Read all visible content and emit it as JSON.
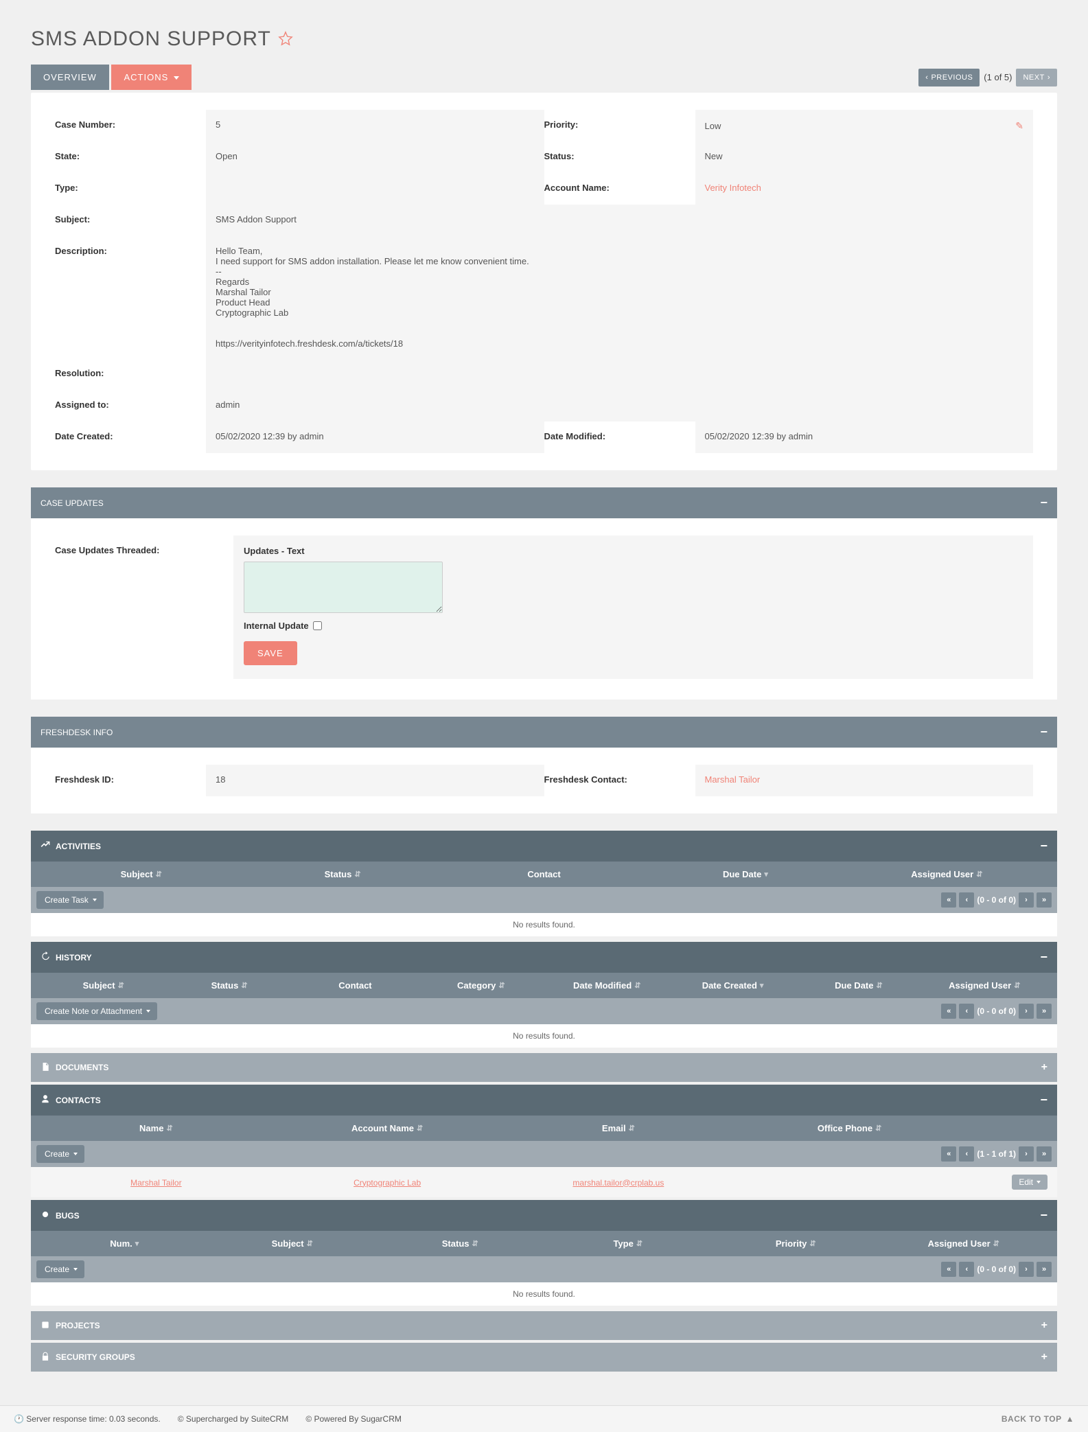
{
  "page_title": "SMS ADDON SUPPORT",
  "tabs": {
    "overview": "OVERVIEW",
    "actions": "ACTIONS"
  },
  "nav": {
    "prev": "PREVIOUS",
    "pos": "(1 of 5)",
    "next": "NEXT"
  },
  "case": {
    "labels": {
      "case_number": "Case Number:",
      "priority": "Priority:",
      "state": "State:",
      "status": "Status:",
      "type": "Type:",
      "account_name": "Account Name:",
      "subject": "Subject:",
      "description": "Description:",
      "resolution": "Resolution:",
      "assigned_to": "Assigned to:",
      "date_created": "Date Created:",
      "date_modified": "Date Modified:"
    },
    "case_number": "5",
    "priority": "Low",
    "state": "Open",
    "status": "New",
    "type": "",
    "account_name": "Verity Infotech",
    "subject": "SMS Addon Support",
    "description": "Hello Team,\nI need support for SMS addon installation. Please let me know convenient time.\n--\nRegards\nMarshal Tailor\nProduct Head\nCryptographic Lab\n\n\nhttps://verityinfotech.freshdesk.com/a/tickets/18",
    "resolution": "",
    "assigned_to": "admin",
    "date_created": "05/02/2020 12:39 by admin",
    "date_modified": "05/02/2020 12:39 by admin"
  },
  "case_updates": {
    "header": "CASE UPDATES",
    "threaded_label": "Case Updates Threaded:",
    "updates_text_label": "Updates - Text",
    "internal_update_label": "Internal Update",
    "save": "SAVE"
  },
  "freshdesk": {
    "header": "FRESHDESK INFO",
    "id_label": "Freshdesk ID:",
    "id_value": "18",
    "contact_label": "Freshdesk Contact:",
    "contact_value": "Marshal Tailor"
  },
  "subpanels": {
    "activities": {
      "title": "ACTIVITIES",
      "cols": [
        "Subject",
        "Status",
        "Contact",
        "Due Date",
        "Assigned User"
      ],
      "create": "Create Task",
      "pager_range": "(0 - 0 of 0)",
      "empty": "No results found."
    },
    "history": {
      "title": "HISTORY",
      "cols": [
        "Subject",
        "Status",
        "Contact",
        "Category",
        "Date Modified",
        "Date Created",
        "Due Date",
        "Assigned User"
      ],
      "create": "Create Note or Attachment",
      "pager_range": "(0 - 0 of 0)",
      "empty": "No results found."
    },
    "documents": {
      "title": "DOCUMENTS"
    },
    "contacts": {
      "title": "CONTACTS",
      "cols": [
        "Name",
        "Account Name",
        "Email",
        "Office Phone"
      ],
      "create": "Create",
      "pager_range": "(1 - 1 of 1)",
      "row": {
        "name": "Marshal Tailor",
        "account": "Cryptographic Lab",
        "email": "marshal.tailor@crplab.us",
        "phone": ""
      },
      "edit": "Edit"
    },
    "bugs": {
      "title": "BUGS",
      "cols": [
        "Num.",
        "Subject",
        "Status",
        "Type",
        "Priority",
        "Assigned User"
      ],
      "create": "Create",
      "pager_range": "(0 - 0 of 0)",
      "empty": "No results found."
    },
    "projects": {
      "title": "PROJECTS"
    },
    "security": {
      "title": "SECURITY GROUPS"
    }
  },
  "footer": {
    "response_time": "Server response time: 0.03 seconds.",
    "supercharged": "© Supercharged by SuiteCRM",
    "powered": "© Powered By SugarCRM",
    "back_to_top": "BACK TO TOP"
  }
}
